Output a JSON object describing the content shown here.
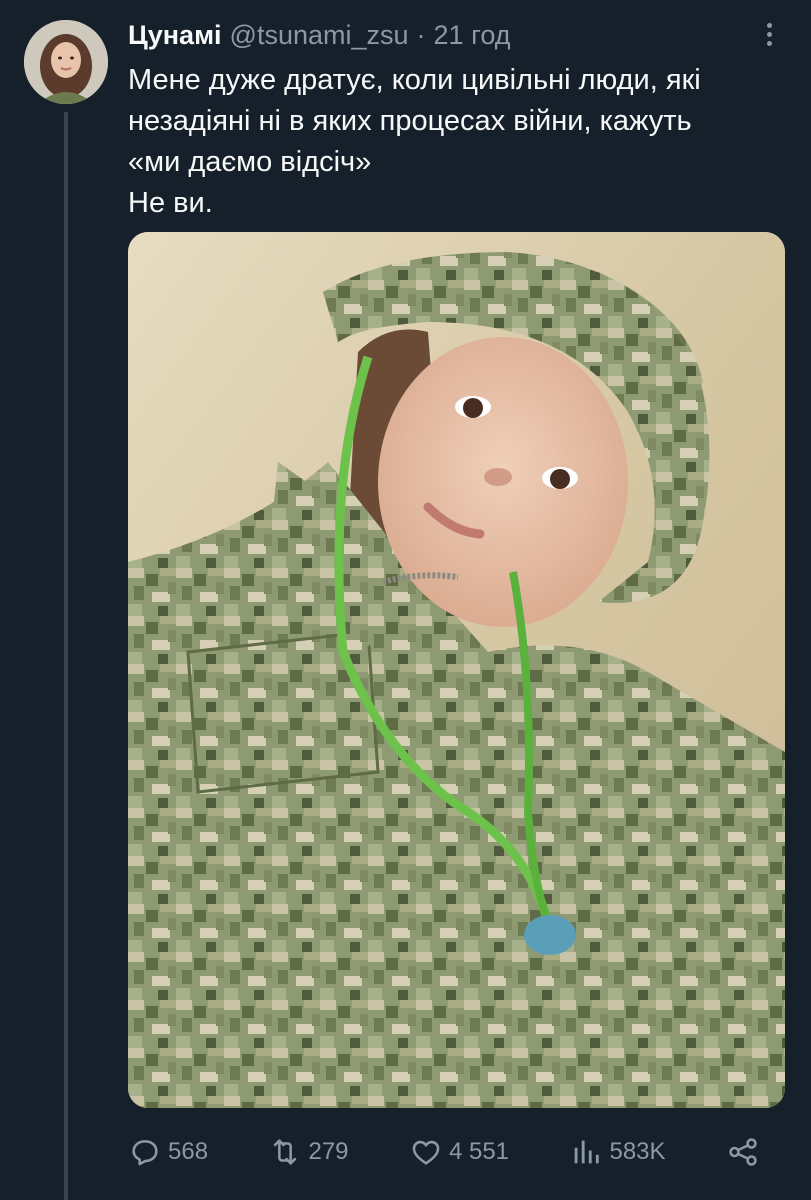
{
  "tweet": {
    "author_name": "Цунамі",
    "handle": "@tsunami_zsu",
    "separator": "·",
    "time": "21 год",
    "text_lines": [
      "Мене дуже дратує, коли цивільні люди, які",
      "незадіяні ні в яких процесах війни, кажуть",
      "«ми даємо відсіч»",
      "Не ви."
    ]
  },
  "actions": {
    "replies": "568",
    "retweets": "279",
    "likes": "4 551",
    "views": "583K"
  },
  "icons": {
    "reply": "reply-icon",
    "retweet": "retweet-icon",
    "like": "heart-icon",
    "views": "views-icon",
    "share": "share-icon",
    "more": "more-vertical-icon"
  },
  "colors": {
    "background": "#15202b",
    "text_primary": "#f7f9f9",
    "text_secondary": "#8b98a5",
    "thread_line": "#38444d"
  }
}
